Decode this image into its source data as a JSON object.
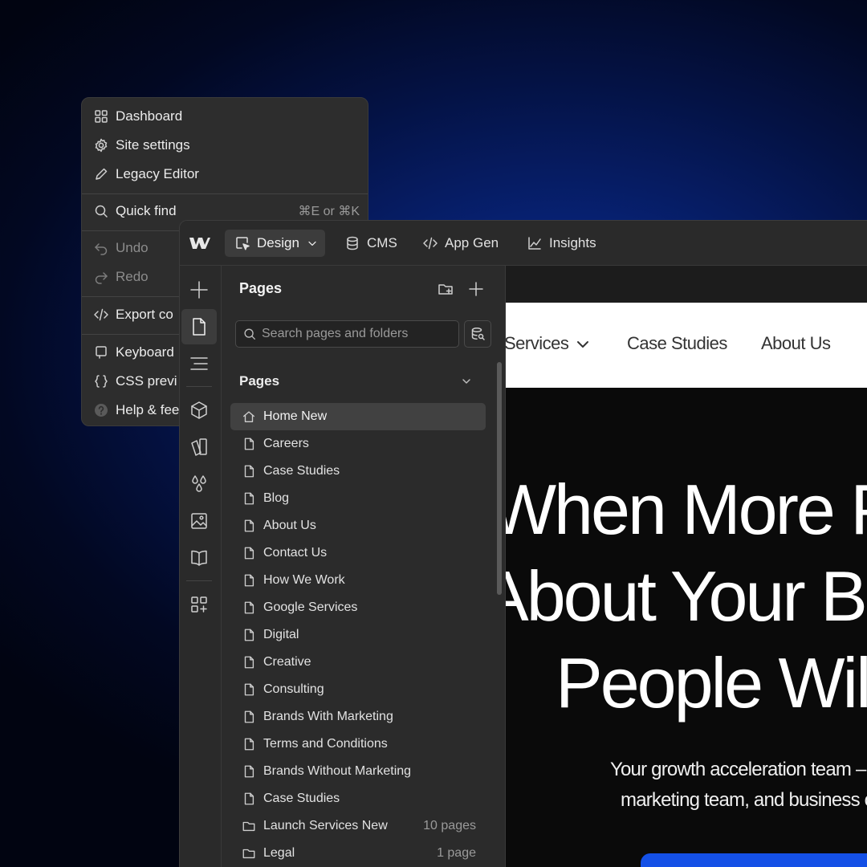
{
  "menu": {
    "items": [
      {
        "label": "Dashboard",
        "icon": "grid-icon",
        "shortcut": "",
        "disabled": false
      },
      {
        "label": "Site settings",
        "icon": "gear-icon",
        "shortcut": "",
        "disabled": false
      },
      {
        "label": "Legacy Editor",
        "icon": "pencil-icon",
        "shortcut": "",
        "disabled": false
      },
      {
        "label": "Quick find",
        "icon": "search-icon",
        "shortcut": "⌘E or ⌘K",
        "disabled": false
      },
      {
        "label": "Undo",
        "icon": "undo-icon",
        "shortcut": "",
        "disabled": true
      },
      {
        "label": "Redo",
        "icon": "redo-icon",
        "shortcut": "",
        "disabled": true
      },
      {
        "label": "Export co",
        "icon": "code-icon",
        "shortcut": "",
        "disabled": false
      },
      {
        "label": "Keyboard",
        "icon": "keyboard-icon",
        "shortcut": "",
        "disabled": false
      },
      {
        "label": "CSS previ",
        "icon": "braces-icon",
        "shortcut": "",
        "disabled": false
      },
      {
        "label": "Help & fee",
        "icon": "help-icon",
        "shortcut": "",
        "disabled": false
      }
    ]
  },
  "topbar": {
    "mode": "Design",
    "nav": [
      {
        "label": "CMS",
        "icon": "database-icon"
      },
      {
        "label": "App Gen",
        "icon": "code-icon"
      },
      {
        "label": "Insights",
        "icon": "chart-icon"
      }
    ]
  },
  "panel": {
    "title": "Pages",
    "search_placeholder": "Search pages and folders",
    "section_title": "Pages",
    "pages": [
      {
        "label": "Home New",
        "icon": "home-icon",
        "meta": "",
        "selected": true
      },
      {
        "label": "Careers",
        "icon": "page-icon",
        "meta": ""
      },
      {
        "label": "Case Studies",
        "icon": "page-icon",
        "meta": ""
      },
      {
        "label": "Blog",
        "icon": "page-icon",
        "meta": ""
      },
      {
        "label": "About Us",
        "icon": "page-icon",
        "meta": ""
      },
      {
        "label": "Contact Us",
        "icon": "page-icon",
        "meta": ""
      },
      {
        "label": "How We Work",
        "icon": "page-icon",
        "meta": ""
      },
      {
        "label": "Google Services",
        "icon": "page-icon",
        "meta": ""
      },
      {
        "label": "Digital",
        "icon": "page-icon",
        "meta": ""
      },
      {
        "label": "Creative",
        "icon": "page-icon",
        "meta": ""
      },
      {
        "label": "Consulting",
        "icon": "page-icon",
        "meta": ""
      },
      {
        "label": "Brands With Marketing",
        "icon": "page-icon",
        "meta": ""
      },
      {
        "label": "Terms and Conditions",
        "icon": "page-icon",
        "meta": ""
      },
      {
        "label": "Brands Without Marketing",
        "icon": "page-icon",
        "meta": ""
      },
      {
        "label": "Case Studies",
        "icon": "page-icon",
        "meta": ""
      },
      {
        "label": "Launch Services New",
        "icon": "folder-icon",
        "meta": "10 pages"
      },
      {
        "label": "Legal",
        "icon": "folder-icon",
        "meta": "1 page"
      }
    ]
  },
  "canvas": {
    "nav_links": [
      "Services",
      "Case Studies",
      "About Us"
    ],
    "hero_lines": [
      "When More P",
      "About Your Bu",
      "People Wil"
    ],
    "hero_sub": [
      "Your growth acceleration team –",
      "marketing team, and business c"
    ]
  },
  "colors": {
    "cta": "#1450e6",
    "panel_bg": "#2b2b2b",
    "selected_row": "#414141"
  }
}
